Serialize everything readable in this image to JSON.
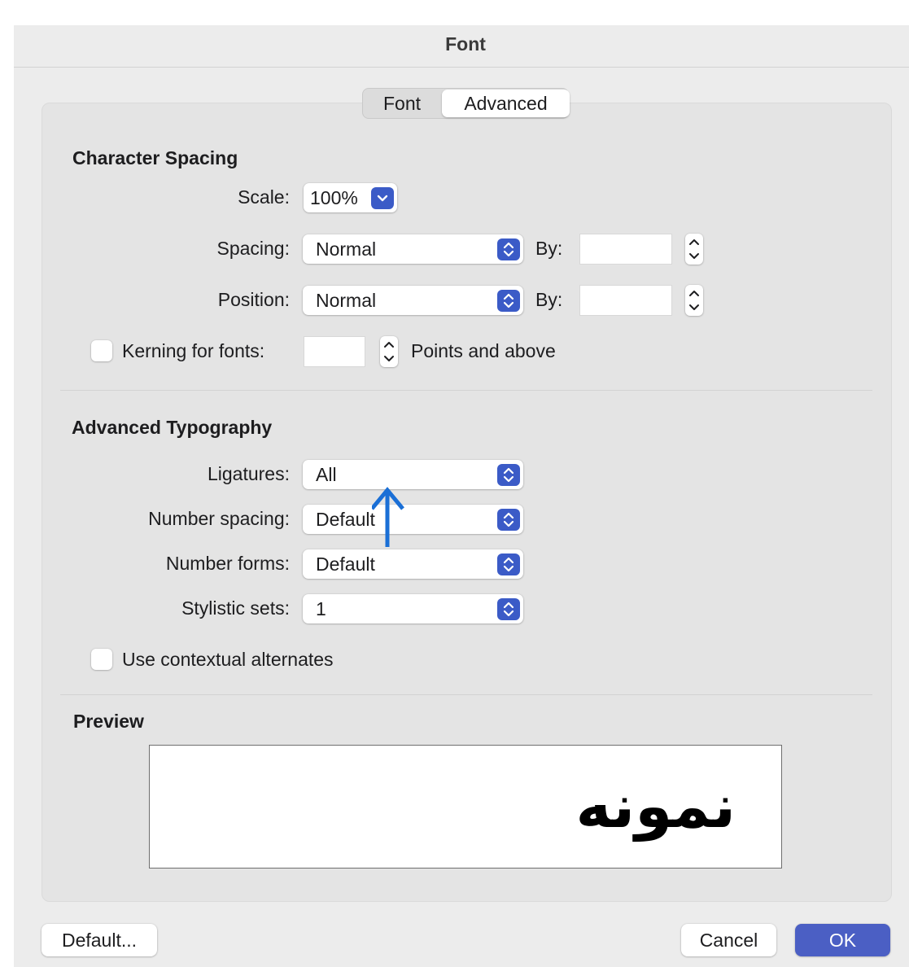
{
  "window": {
    "title": "Font"
  },
  "tabs": [
    {
      "label": "Font",
      "selected": false
    },
    {
      "label": "Advanced",
      "selected": true
    }
  ],
  "character_spacing": {
    "heading": "Character Spacing",
    "scale": {
      "label": "Scale:",
      "value": "100%"
    },
    "spacing": {
      "label": "Spacing:",
      "value": "Normal",
      "by_label": "By:",
      "by_value": ""
    },
    "position": {
      "label": "Position:",
      "value": "Normal",
      "by_label": "By:",
      "by_value": ""
    },
    "kerning": {
      "label": "Kerning for fonts:",
      "checked": false,
      "value": "",
      "suffix": "Points and above"
    }
  },
  "advanced_typography": {
    "heading": "Advanced Typography",
    "ligatures": {
      "label": "Ligatures:",
      "value": "All"
    },
    "number_spacing": {
      "label": "Number spacing:",
      "value": "Default"
    },
    "number_forms": {
      "label": "Number forms:",
      "value": "Default"
    },
    "stylistic_sets": {
      "label": "Stylistic sets:",
      "value": "1"
    },
    "contextual_alternates": {
      "label": "Use contextual alternates",
      "checked": false
    }
  },
  "preview": {
    "heading": "Preview",
    "sample_text": "نمونه"
  },
  "buttons": {
    "default": "Default...",
    "cancel": "Cancel",
    "ok": "OK"
  },
  "colors": {
    "accent": "#3b5bc7",
    "ok_button": "#4b5fc4",
    "annotation_arrow": "#1a6fd6"
  },
  "icons": {
    "select_indicator": "updown-chevron-icon",
    "scale_indicator": "chevron-down-icon",
    "annotation": "up-arrow-icon"
  }
}
